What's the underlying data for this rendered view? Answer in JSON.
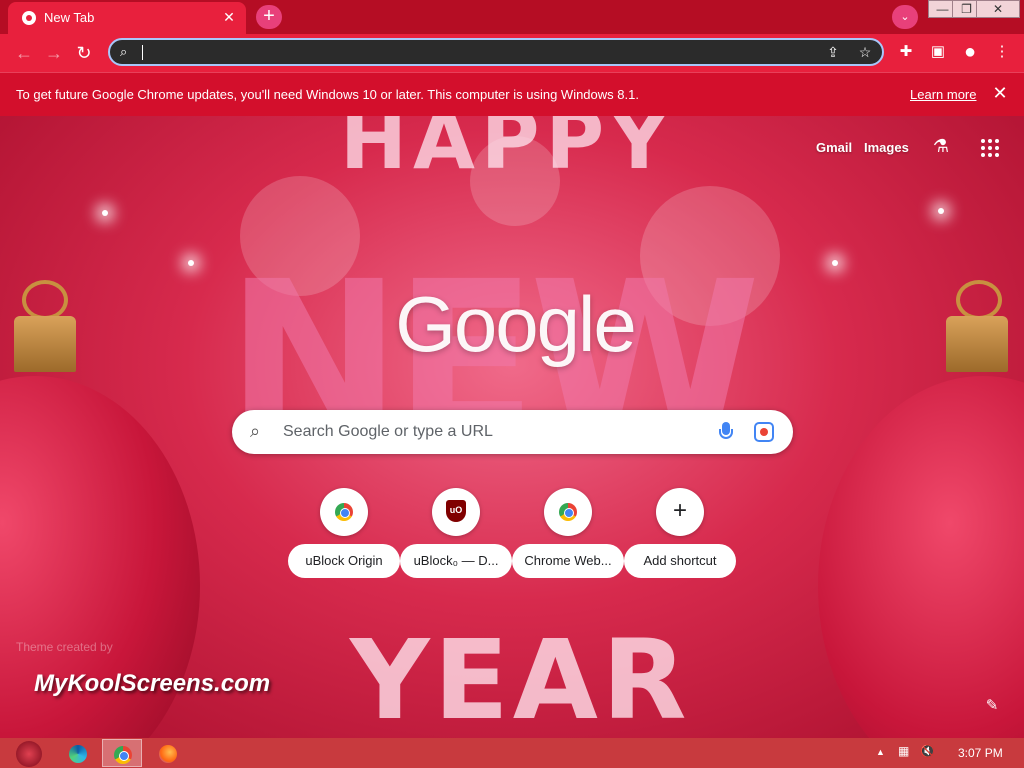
{
  "browser": {
    "tab_title": "New Tab",
    "tab_close": "✕",
    "new_tab_button": "+",
    "tab_search": "⌄",
    "window": {
      "minimize": "—",
      "maximize": "❐",
      "close": "✕"
    },
    "nav": {
      "back": "←",
      "forward": "→",
      "reload": "↻"
    },
    "omnibox": {
      "value": ""
    },
    "toolbar_icons": {
      "share": "⇪",
      "bookmark": "☆",
      "extensions": "✚",
      "sidepanel": "▣",
      "profile": "●",
      "menu": "⋮"
    }
  },
  "infobar": {
    "message": "To get future Google Chrome updates, you'll need Windows 10 or later. This computer is using Windows 8.1.",
    "link": "Learn more",
    "close": "✕"
  },
  "ntp": {
    "top_links": {
      "gmail": "Gmail",
      "images": "Images",
      "labs": "⚗"
    },
    "logo": "Google",
    "search_placeholder": "Search Google or type a URL",
    "shortcuts": [
      {
        "label": "uBlock Origin",
        "icon": "chrome-icon"
      },
      {
        "label": "uBlock₀ — D...",
        "icon": "ublock-icon"
      },
      {
        "label": "Chrome Web...",
        "icon": "chrome-icon"
      },
      {
        "label": "Add shortcut",
        "icon": "plus-icon"
      }
    ],
    "ublock_glyph": "uO",
    "plus_glyph": "+",
    "theme_credit": "Theme created by",
    "brand_watermark": "MyKoolScreens.com",
    "customize_icon": "✎",
    "background_text": {
      "top": "HAPPY",
      "middle": "NEW",
      "bottom": "YEAR"
    }
  },
  "taskbar": {
    "tray": {
      "up_arrow": "▲",
      "network": "▦",
      "volume": "🔇"
    },
    "clock": "3:07 PM"
  },
  "colors": {
    "titlebar": "#b50d24",
    "toolbar": "#e8203d",
    "infobar": "#d30f2c",
    "omnibox_border": "#a8c7fa",
    "taskbar": "#c83a3e"
  }
}
